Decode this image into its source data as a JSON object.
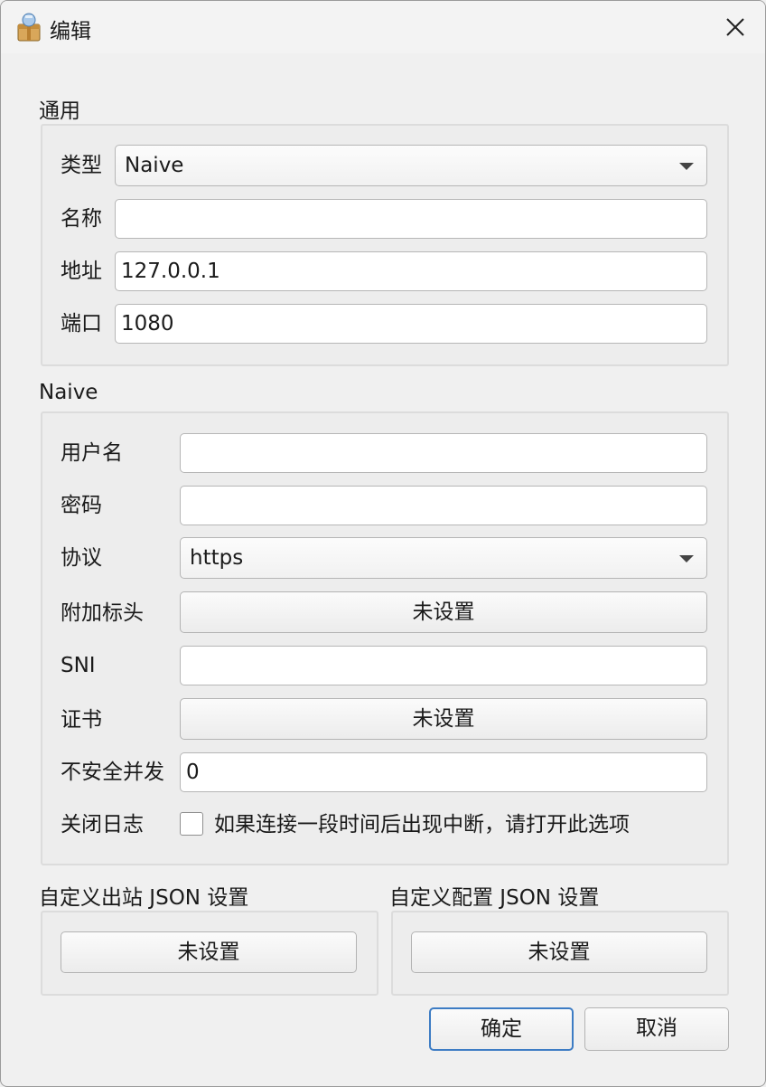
{
  "window": {
    "title": "编辑"
  },
  "general": {
    "title": "通用",
    "type_label": "类型",
    "type_value": "Naive",
    "name_label": "名称",
    "name_value": "",
    "address_label": "地址",
    "address_value": "127.0.0.1",
    "port_label": "端口",
    "port_value": "1080"
  },
  "naive": {
    "title": "Naive",
    "username_label": "用户名",
    "username_value": "",
    "password_label": "密码",
    "password_value": "",
    "protocol_label": "协议",
    "protocol_value": "https",
    "extra_headers_label": "附加标头",
    "extra_headers_button": "未设置",
    "sni_label": "SNI",
    "sni_value": "",
    "cert_label": "证书",
    "cert_button": "未设置",
    "insecure_concurrency_label": "不安全并发",
    "insecure_concurrency_value": "0",
    "disable_log_label": "关闭日志",
    "disable_log_hint": "如果连接一段时间后出现中断，请打开此选项"
  },
  "custom_outbound": {
    "title": "自定义出站 JSON 设置",
    "button": "未设置"
  },
  "custom_config": {
    "title": "自定义配置 JSON 设置",
    "button": "未设置"
  },
  "dialog": {
    "ok": "确定",
    "cancel": "取消"
  },
  "colors": {
    "accent": "#3d7cc4",
    "background": "#f0f0f0"
  }
}
